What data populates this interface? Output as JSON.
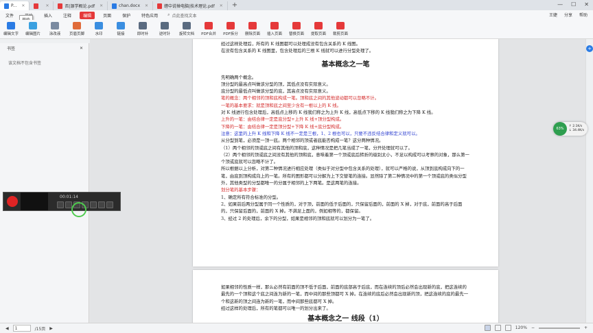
{
  "tabs": [
    {
      "label": "P...",
      "color": "#2a7be4",
      "active": true
    },
    {
      "label": "",
      "color": "#e5393a"
    },
    {
      "label": "否|源学概论.pdf",
      "color": "#e5393a"
    },
    {
      "label": "chan.docx",
      "color": "#2a7be4"
    },
    {
      "label": "缠中说禅电脑|技术理论.pdf",
      "color": "#e5393a"
    }
  ],
  "tooltip": "开始",
  "menu": {
    "items": [
      "文件",
      "开始",
      "插入",
      "注释",
      "编辑",
      "页面",
      "保护",
      "特色应用"
    ],
    "selected": "编辑",
    "search": "点此查找文本",
    "right": [
      "王婕",
      "分享",
      "帮助"
    ]
  },
  "ribbon": [
    {
      "label": "编辑文字",
      "color": "#2a7be4"
    },
    {
      "label": "编辑图片",
      "color": "#3aa0e0"
    },
    {
      "label": "涂改液",
      "color": "#7a8aa0"
    },
    {
      "label": "页眉页脚",
      "color": "#e06b3a"
    },
    {
      "label": "水印",
      "color": "#3a8ee0"
    },
    {
      "label": "链接",
      "color": "#3a8ee0"
    },
    {
      "label": "即时补",
      "color": "#5a6b80"
    },
    {
      "label": "逆时针",
      "color": "#5a6b80"
    },
    {
      "label": "旋转文档",
      "color": "#5a6b80"
    },
    {
      "label": "PDF合并",
      "color": "#e5393a"
    },
    {
      "label": "PDF拆分",
      "color": "#e5393a"
    },
    {
      "label": "删除页面",
      "color": "#e5393a"
    },
    {
      "label": "插入页面",
      "color": "#e5393a"
    },
    {
      "label": "替换页面",
      "color": "#e5393a"
    },
    {
      "label": "提取页面",
      "color": "#e5393a"
    },
    {
      "label": "裁剪页面",
      "color": "#e5393a"
    }
  ],
  "sidepanel": {
    "title": "书签",
    "empty": "该文档不包含书签"
  },
  "page1": {
    "intro": [
      "经过这样处理后，所有的 K 线图都可以处理成没有包含关系的 K 线图。",
      "在没有包含关系的 K 线图里，包含处理后的三根 K 线就可以进行分型处理了。"
    ],
    "heading": "基本概念之一笔",
    "body": [
      {
        "t": "先明确两个概念。",
        "c": ""
      },
      {
        "t": "顶分型的最高点叫做该分型的顶，其低点没有实际意义。",
        "c": ""
      },
      {
        "t": "底分型的最低点叫做该分型的底，其高点没有实际意义。",
        "c": ""
      },
      {
        "t": "笔的概念：两个相邻的顶和底构成一笔。顶和底之间的其他波动都可以忽略不计。",
        "c": "red"
      },
      {
        "t": "一笔的基本要求：就是顶和底之间至少含有一根以上的 K 线。",
        "c": "red"
      },
      {
        "t": "对 K 线进行包含处理后，高低点上移的 K 线我们称之为上升 K 线，高低点下移的 K 线我们称之为下降 K 线。",
        "c": ""
      },
      {
        "t": "上升的一笔：由结合律一定是底分型+上升 K 线+顶分型构成。",
        "c": "red"
      },
      {
        "t": "下降的一笔：由结合律一定是顶分型+下降 K 线+底分型构成。",
        "c": "red"
      },
      {
        "t": "注意：这里的上升 K 线和下降 K 线不一定是三根，1、2 根也可以，只要不违反结合律和定义就可以。",
        "c": "blue"
      },
      {
        "t": "从分型到笔，必须是一顶一底。两个相邻的顶或者底能否构成一笔？这分两种情况。",
        "c": ""
      },
      {
        "t": "（1）两个相邻的顶或底之间有其他的顶和底，这种情况是把几笔当成了一笔，分开处理就可以了。",
        "c": ""
      },
      {
        "t": "（2）两个相邻的顶或底之间没有其他的顶和底，意味着第一个顶或底后转折的级别太小，不足以构成可以考察的对象，那么第一个顶或底就可以忽略不计了。",
        "c": "",
        "wrap": true
      },
      {
        "t": "所以根据以上分析，对第二种情况进行相应处理（类似于对分型中包含关系的处理），就可以严格的说，从顶到底构成向下的一笔，由底到顶构成向上的一笔。所有的图形都可以分解为上下交替笔的连接。显然除了第二种情况中的第一个顶或底的类似分型外，其他类型的分型都唯一的分属于相邻的上下两笔。是这两笔的连接。",
        "c": "",
        "wrap": true
      },
      {
        "t": "划分笔的基本步骤：",
        "c": "red"
      },
      {
        "t": "1、确定所有符合标准的分型。",
        "c": ""
      },
      {
        "t": "2、如果前后两分型属于同一个性质的，对于顶，前面的低于后面的，只保留后面的，前面的 X 掉，对于底，前面的高于后面的，只保留后面的，前面的 X 掉。不满足上面的，例如相等的，都保留。",
        "c": "",
        "wrap": true
      },
      {
        "t": "3、经过 2 的处理后，余下的分型，如果是相邻的顶和底就可以划分为一笔了。",
        "c": ""
      }
    ]
  },
  "page2": {
    "body": [
      "如果相邻的性质一样，那么必然有前面的顶不低于后面，前面的底部高于后底，而在连续的顶后必然会出现新的底，把这连续的最先的一个顶和这个底之间连为新的一笔，而中间的那些顶都可 X 掉。在连续的底后必然会出现新的顶，把这连续的底的最先一个和这新的顶之间连为新的一笔，而中间那些底都可 X 掉。",
      "经过这样的处理后，所有的笔都可以唯一的划分出来了。"
    ],
    "heading_partial": "基本概念之一 线段（1）"
  },
  "recorder": {
    "time": "00:01:14"
  },
  "net": {
    "percent": "63%",
    "up": "2.1K/s",
    "down": "34.4K/s"
  },
  "status": {
    "page": "1",
    "total": "/15页",
    "zoom": "120%"
  }
}
